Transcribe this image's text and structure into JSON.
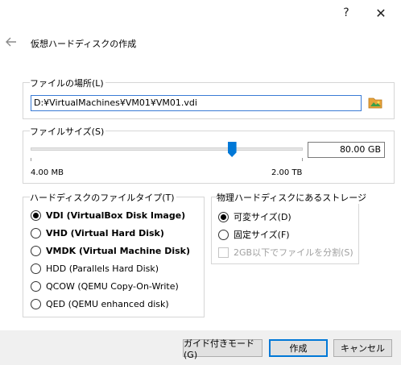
{
  "titlebar": {
    "help_label": "?",
    "close_label": "✕"
  },
  "wizard": {
    "back_icon": "back-arrow-icon",
    "title": "仮想ハードディスクの作成"
  },
  "file_location": {
    "group_label": "ファイルの場所(L)",
    "path_value": "D:¥VirtualMachines¥VM01¥VM01.vdi",
    "folder_icon": "folder-icon"
  },
  "file_size": {
    "group_label": "ファイルサイズ(S)",
    "value": "80.00 GB",
    "min_label": "4.00 MB",
    "max_label": "2.00 TB",
    "slider_fraction": 0.74
  },
  "disk_type": {
    "group_label": "ハードディスクのファイルタイプ(T)",
    "options": [
      {
        "label": "VDI (VirtualBox Disk Image)",
        "checked": true,
        "bold": true
      },
      {
        "label": "VHD (Virtual Hard Disk)",
        "checked": false,
        "bold": true
      },
      {
        "label": "VMDK (Virtual Machine Disk)",
        "checked": false,
        "bold": true
      },
      {
        "label": "HDD (Parallels Hard Disk)",
        "checked": false,
        "bold": false
      },
      {
        "label": "QCOW (QEMU Copy-On-Write)",
        "checked": false,
        "bold": false
      },
      {
        "label": "QED (QEMU enhanced disk)",
        "checked": false,
        "bold": false
      }
    ]
  },
  "storage": {
    "group_label": "物理ハードディスクにあるストレージ",
    "options": [
      {
        "label": "可変サイズ(D)",
        "checked": true
      },
      {
        "label": "固定サイズ(F)",
        "checked": false
      }
    ],
    "split_label": "2GB以下でファイルを分割(S)",
    "split_checked": false
  },
  "buttons": {
    "guided": "ガイド付きモード(G)",
    "create": "作成",
    "cancel": "キャンセル"
  },
  "colors": {
    "accent": "#0078d7",
    "folder": "#e8a33a"
  }
}
